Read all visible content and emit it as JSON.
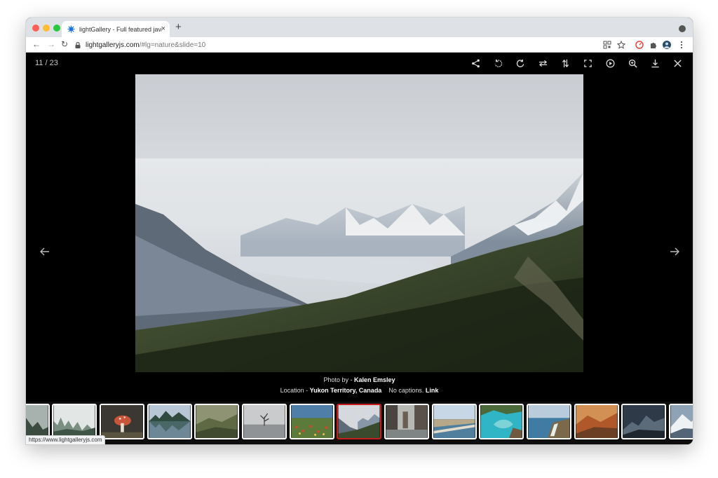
{
  "browser": {
    "tab_title": "lightGallery - Full featured java",
    "close_glyph": "×",
    "new_tab_glyph": "+",
    "url_host": "lightgalleryjs.com",
    "url_rest": "/#lg=nature&slide=10",
    "back_glyph": "←",
    "forward_glyph": "→",
    "reload_glyph": "↻",
    "status_text": "https://www.lightgalleryjs.com"
  },
  "gallery": {
    "counter": "11 / 23",
    "tools": [
      "share-icon",
      "rotate-left-icon",
      "rotate-right-icon",
      "flip-horizontal-icon",
      "flip-vertical-icon",
      "fullscreen-icon",
      "autoplay-icon",
      "zoom-in-icon",
      "download-icon",
      "close-icon"
    ],
    "caption": {
      "photo_by_prefix": "Photo by - ",
      "photographer": "Kalen Emsley",
      "location_prefix": "Location - ",
      "location": "Yukon Territory, Canada",
      "no_captions": "No captions.",
      "link": "Link"
    },
    "thumbnails": [
      "forest",
      "misty-forest",
      "mushroom",
      "lake-reflection",
      "foggy-hills",
      "lone-tree",
      "flower-field",
      "mountain-valley",
      "sea-cliffs",
      "coast-road",
      "turquoise-bay",
      "coastline",
      "autumn-hills",
      "dusk-mountains",
      "snowy-peaks"
    ],
    "active_thumbnail": 7
  },
  "colors": {
    "viewer_bg": "#000000",
    "active_border": "#c81d1d",
    "favicon": "#1a73e8"
  }
}
